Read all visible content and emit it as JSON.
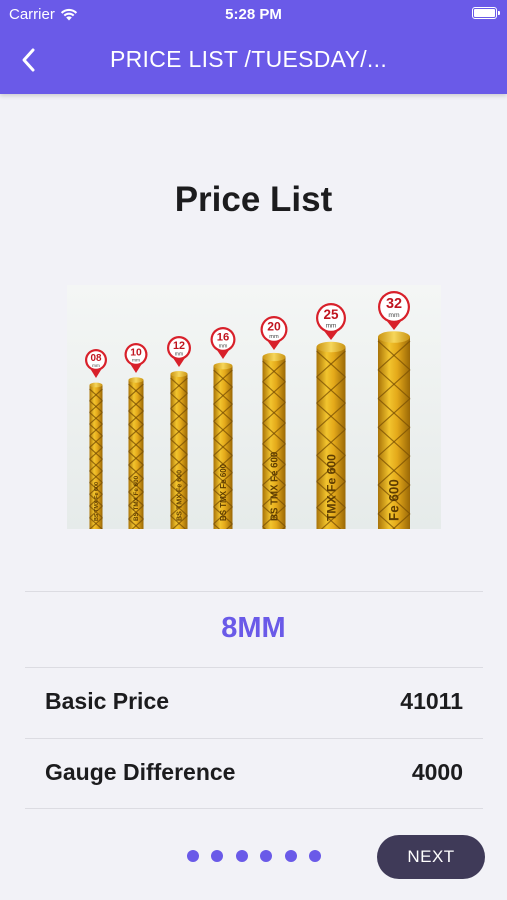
{
  "status_bar": {
    "carrier": "Carrier",
    "time": "5:28 PM"
  },
  "nav": {
    "title": "PRICE LIST /TUESDAY/..."
  },
  "heading": "Price List",
  "product_image": {
    "alt": "TMT bars 08mm to 32mm",
    "bars": [
      {
        "size": "08",
        "unit": "mm",
        "stamp": "BS TMX Fe 600"
      },
      {
        "size": "10",
        "unit": "mm",
        "stamp": "BS TMX Fe 600"
      },
      {
        "size": "12",
        "unit": "mm",
        "stamp": "BS TMX Fe 600"
      },
      {
        "size": "16",
        "unit": "mm",
        "stamp": "BS TMX Fe 600"
      },
      {
        "size": "20",
        "unit": "mm",
        "stamp": "BS TMX Fe 600"
      },
      {
        "size": "25",
        "unit": "mm",
        "stamp": "TMX Fe 600"
      },
      {
        "size": "32",
        "unit": "mm",
        "stamp": "Fe 600"
      }
    ]
  },
  "selected_size": "8MM",
  "rows": [
    {
      "label": "Basic Price",
      "value": "41011"
    },
    {
      "label": "Gauge Difference",
      "value": "4000"
    }
  ],
  "pager": {
    "count": 6
  },
  "next_label": "NEXT",
  "colors": {
    "accent": "#6a5ae8",
    "button": "#3f3a58",
    "background": "#f2f2f7",
    "bar_gold": "#e0a819",
    "marker_red": "#d8202a"
  }
}
